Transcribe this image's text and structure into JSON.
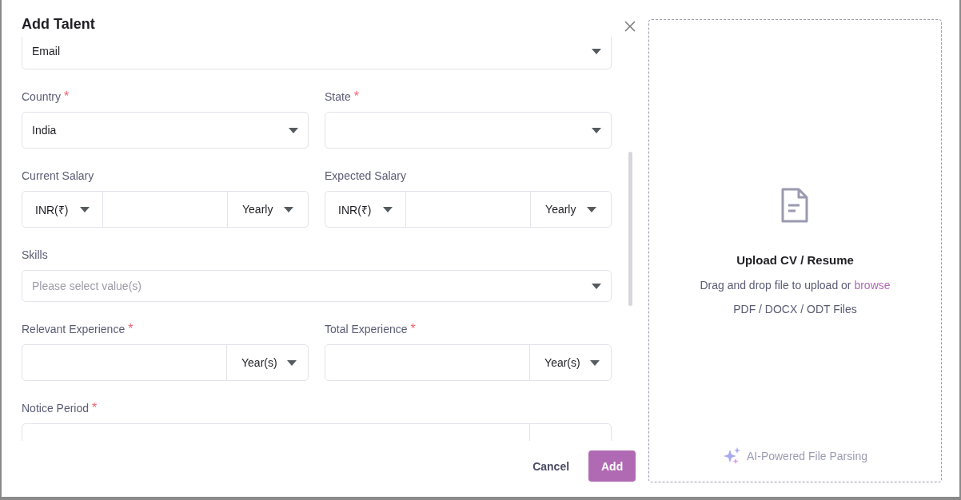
{
  "dialog": {
    "title": "Add Talent"
  },
  "form_rows": [
    [
      {
        "kind": "select",
        "value": "Email"
      }
    ],
    [
      {
        "kind": "select",
        "label": "Country",
        "required": true,
        "value": "India"
      },
      {
        "kind": "select",
        "label": "State",
        "required": true
      }
    ],
    [
      {
        "kind": "salary",
        "label": "Current Salary",
        "required": false,
        "currency": "INR(₹)",
        "period": "Yearly"
      },
      {
        "kind": "salary",
        "label": "Expected Salary",
        "required": false,
        "currency": "INR(₹)",
        "period": "Yearly"
      }
    ],
    [
      {
        "kind": "multiselect",
        "label": "Skills",
        "required": false,
        "placeholder": "Please select value(s)"
      }
    ],
    [
      {
        "kind": "duration",
        "label": "Relevant Experience",
        "required": true,
        "unit": "Year(s)"
      },
      {
        "kind": "duration",
        "label": "Total Experience",
        "required": true,
        "unit": "Year(s)"
      }
    ],
    [
      {
        "kind": "duration",
        "label": "Notice Period",
        "required": true
      }
    ]
  ],
  "required_mark": "*",
  "buttons": {
    "cancel": "Cancel",
    "add": "Add"
  },
  "upload": {
    "title": "Upload CV / Resume",
    "hint": "Drag and drop file to upload or ",
    "link": "browse",
    "formats": "PDF / DOCX / ODT Files",
    "ai_note": "AI-Powered File Parsing"
  }
}
